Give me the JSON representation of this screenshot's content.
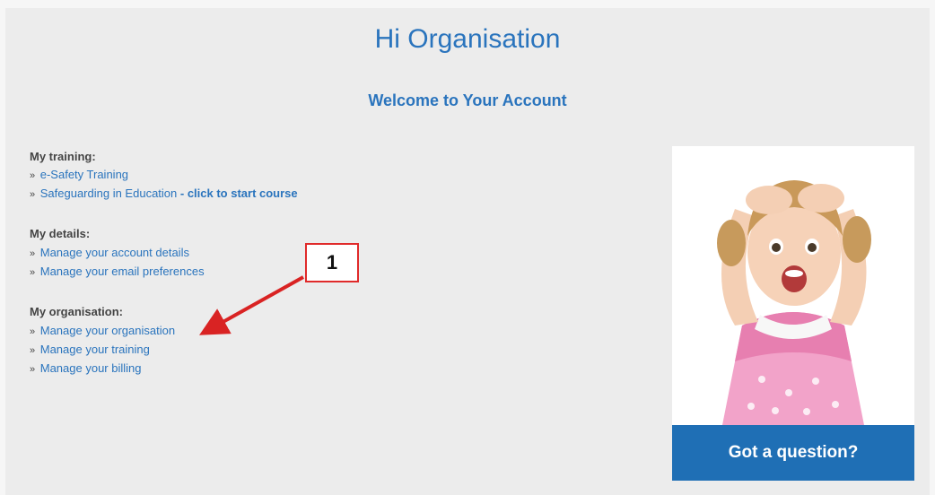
{
  "header": {
    "greeting": "Hi Organisation",
    "welcome": "Welcome to Your Account"
  },
  "sections": {
    "training": {
      "heading": "My training:",
      "items": [
        {
          "label": "e-Safety Training",
          "suffix": ""
        },
        {
          "label": "Safeguarding in Education",
          "suffix": " - click to start course"
        }
      ]
    },
    "details": {
      "heading": "My details:",
      "items": [
        {
          "label": "Manage your account details"
        },
        {
          "label": "Manage your email preferences"
        }
      ]
    },
    "organisation": {
      "heading": "My organisation:",
      "items": [
        {
          "label": "Manage your organisation"
        },
        {
          "label": "Manage your training"
        },
        {
          "label": "Manage your billing"
        }
      ]
    }
  },
  "bullet": "»",
  "annotation": {
    "number": "1"
  },
  "sidebar_card": {
    "button_label": "Got a question?"
  },
  "colors": {
    "link": "#2a74bd",
    "cta": "#e8141a",
    "button": "#1f6fb5",
    "annotation": "#d92323"
  },
  "icons": {
    "bullet": "chevron-right-double-icon",
    "photo": "child-photo"
  }
}
